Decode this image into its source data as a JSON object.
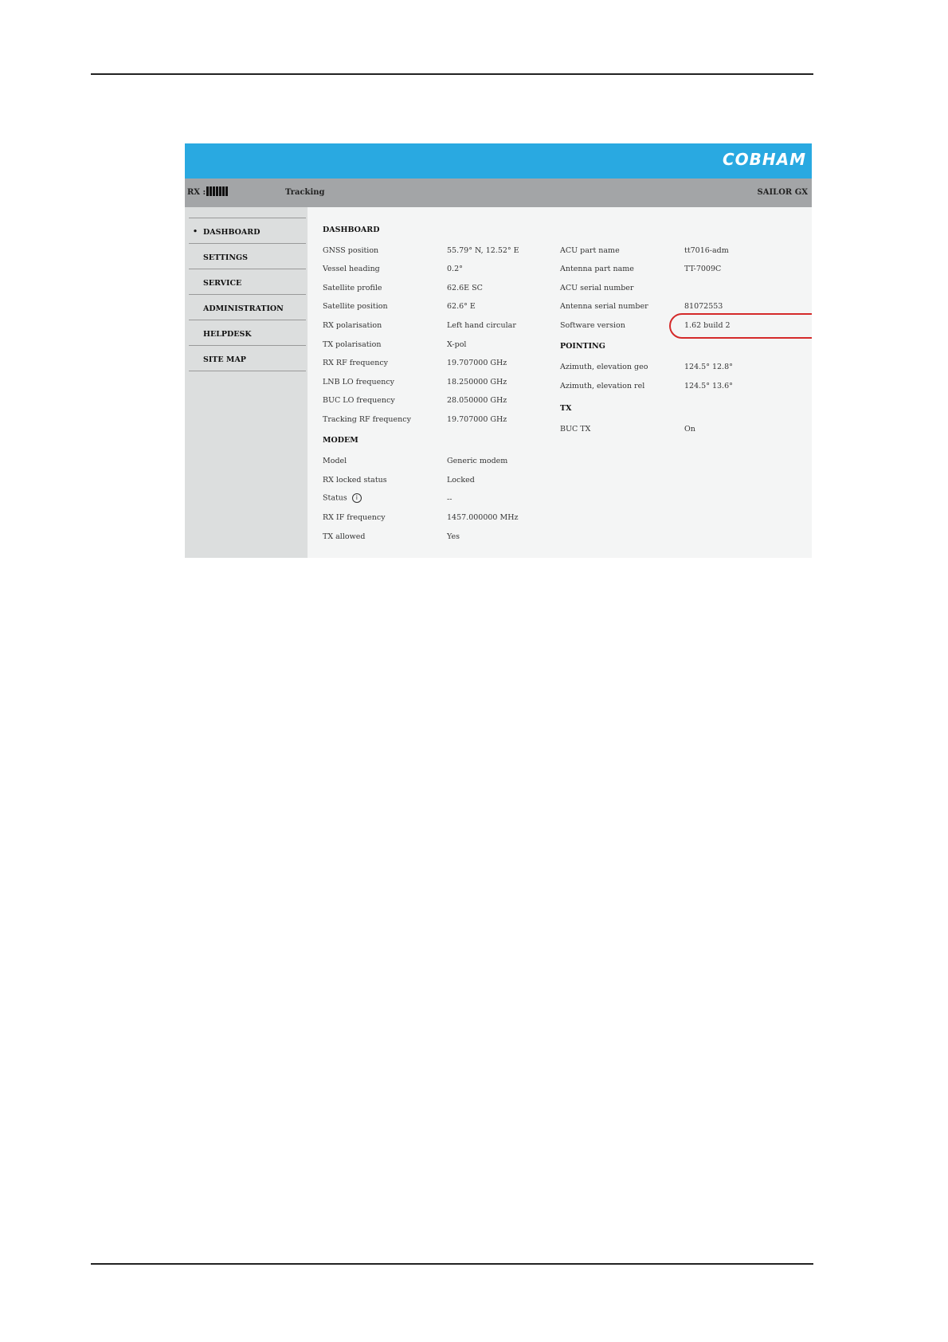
{
  "header": {
    "logo": "COBHAM"
  },
  "statusbar": {
    "rx_label": "RX :",
    "rx_signal_bars": 7,
    "tracking": "Tracking",
    "product": "SAILOR GX"
  },
  "sidebar": {
    "items": [
      {
        "label": "DASHBOARD",
        "active": true
      },
      {
        "label": "SETTINGS"
      },
      {
        "label": "SERVICE"
      },
      {
        "label": "ADMINISTRATION"
      },
      {
        "label": "HELPDESK"
      },
      {
        "label": "SITE MAP"
      }
    ]
  },
  "dashboard": {
    "title": "DASHBOARD",
    "rows": [
      {
        "label": "GNSS position",
        "value": "55.79° N, 12.52° E"
      },
      {
        "label": "Vessel heading",
        "value": "0.2°"
      },
      {
        "label": "Satellite profile",
        "value": "62.6E SC"
      },
      {
        "label": "Satellite position",
        "value": "62.6° E"
      },
      {
        "label": "RX polarisation",
        "value": "Left hand circular"
      },
      {
        "label": "TX polarisation",
        "value": "X-pol"
      },
      {
        "label": "RX RF frequency",
        "value": "19.707000 GHz"
      },
      {
        "label": "LNB LO frequency",
        "value": "18.250000 GHz"
      },
      {
        "label": "BUC LO frequency",
        "value": "28.050000 GHz"
      },
      {
        "label": "Tracking RF frequency",
        "value": "19.707000 GHz"
      }
    ]
  },
  "modem": {
    "title": "MODEM",
    "rows": [
      {
        "label": "Model",
        "value": "Generic modem"
      },
      {
        "label": "RX locked status",
        "value": "Locked"
      },
      {
        "label": "Status",
        "value": "--"
      },
      {
        "label": "RX IF frequency",
        "value": "1457.000000 MHz"
      },
      {
        "label": "TX allowed",
        "value": "Yes"
      }
    ]
  },
  "units": {
    "rows": [
      {
        "label": "ACU part name",
        "value": "tt7016-adm"
      },
      {
        "label": "Antenna part name",
        "value": "TT-7009C"
      },
      {
        "label": "ACU serial number",
        "value": ""
      },
      {
        "label": "Antenna serial number",
        "value": "81072553"
      },
      {
        "label": "Software version",
        "value": "1.62 build 2"
      }
    ]
  },
  "pointing": {
    "title": "POINTING",
    "rows": [
      {
        "label": "Azimuth, elevation geo",
        "value": "124.5° 12.8°"
      },
      {
        "label": "Azimuth, elevation rel",
        "value": "124.5° 13.6°"
      }
    ]
  },
  "tx": {
    "title": "TX",
    "rows": [
      {
        "label": "BUC TX",
        "value": "On"
      }
    ]
  },
  "status_info_icon": "i",
  "highlight_color": "#d42a2a"
}
